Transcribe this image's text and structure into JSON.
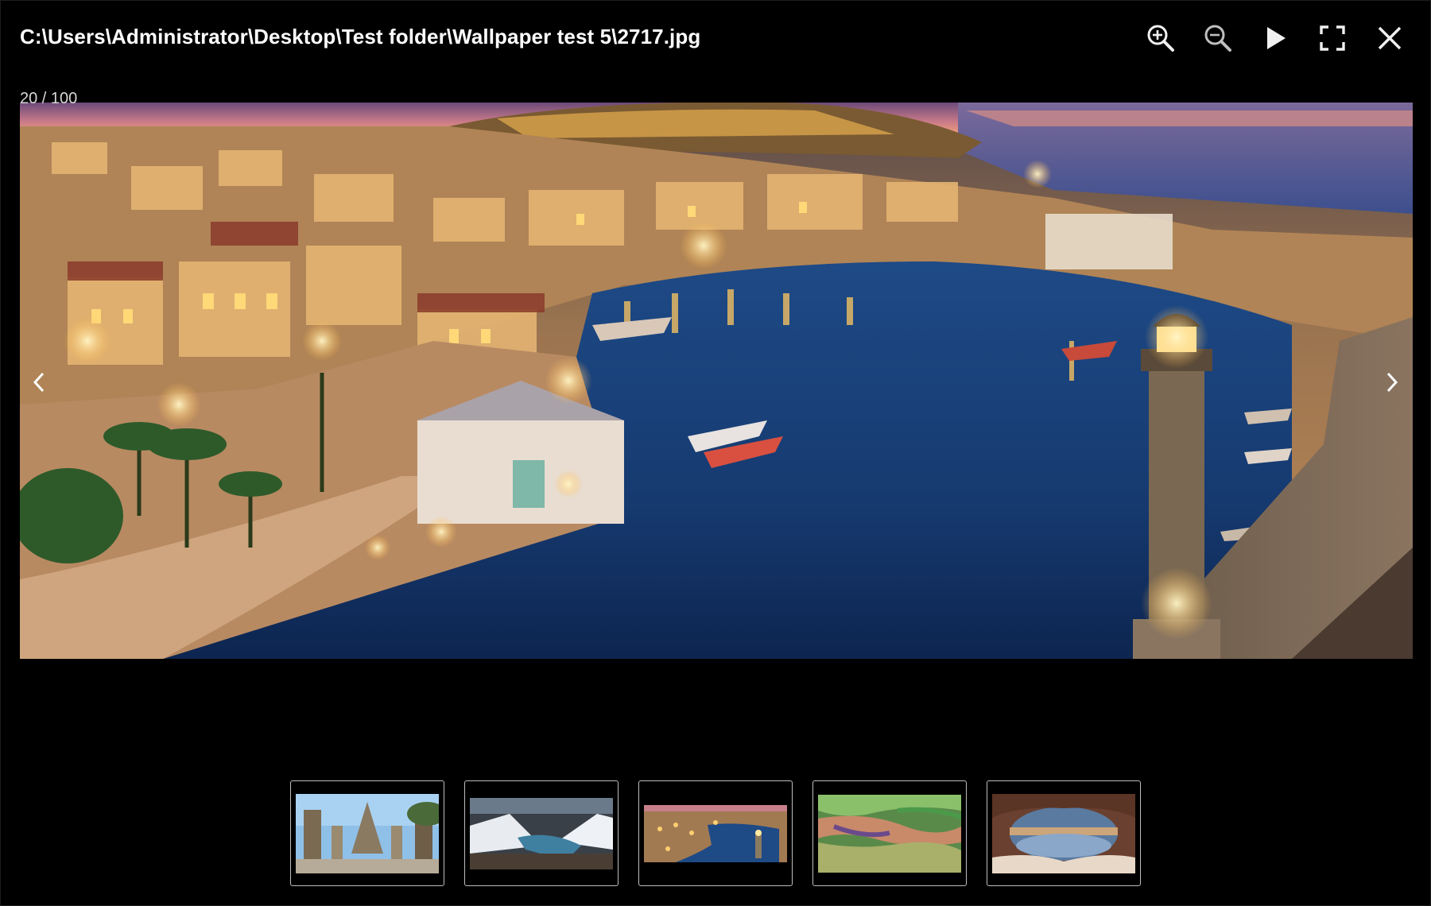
{
  "window": {
    "title": "C:\\Users\\Administrator\\Desktop\\Test folder\\Wallpaper test 5\\2717.jpg"
  },
  "toolbar": {
    "buttons": [
      {
        "name": "zoom-in-button",
        "icon": "zoom-in-icon"
      },
      {
        "name": "zoom-out-button",
        "icon": "zoom-out-icon"
      },
      {
        "name": "slideshow-play-button",
        "icon": "play-icon"
      },
      {
        "name": "fullscreen-button",
        "icon": "fullscreen-icon"
      },
      {
        "name": "close-button",
        "icon": "close-icon"
      }
    ]
  },
  "viewer": {
    "counter": "20 / 100",
    "prev_icon": "chevron-left-icon",
    "next_icon": "chevron-right-icon",
    "image_subject": "night harbor town with lighthouse"
  },
  "thumbnails": [
    {
      "name": "thumbnail-temple-ruins"
    },
    {
      "name": "thumbnail-snowy-mountains"
    },
    {
      "name": "thumbnail-night-harbor",
      "selected": true
    },
    {
      "name": "thumbnail-colorful-fields"
    },
    {
      "name": "thumbnail-ice-cave"
    }
  ],
  "colors": {
    "background": "#000000",
    "title_text": "#ffffff",
    "icon": "#f0f0f0",
    "icon_dim": "#bfbfbf",
    "thumb_border": "#bdbdbd"
  }
}
